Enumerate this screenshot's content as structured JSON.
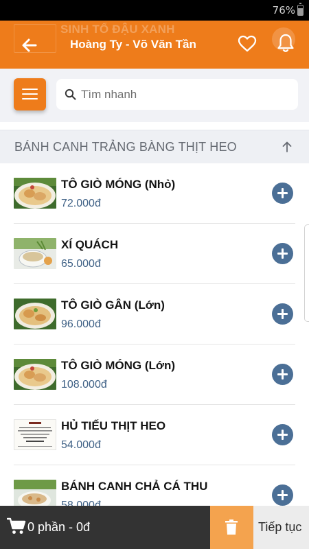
{
  "status_bar": {
    "battery": "76%"
  },
  "header": {
    "title": "Hoàng Ty - Võ Văn Tần",
    "background_text": "SINH TỐ ĐẬU XANH",
    "background_color": "#ee7c1b"
  },
  "search": {
    "placeholder": "Tìm nhanh",
    "value": ""
  },
  "category": {
    "title": "BÁNH CANH TRẢNG BÀNG THỊT HEO"
  },
  "items": [
    {
      "name": "TÔ GIÒ MÓNG (Nhỏ)",
      "price": "72.000đ",
      "thumb": "pork-leg-bowl"
    },
    {
      "name": "XÍ QUÁCH",
      "price": "65.000đ",
      "thumb": "bone-broth"
    },
    {
      "name": "TÔ GIÒ GÂN (Lớn)",
      "price": "96.000đ",
      "thumb": "pork-leg-bowl"
    },
    {
      "name": "TÔ GIÒ MÓNG (Lớn)",
      "price": "108.000đ",
      "thumb": "pork-leg-bowl"
    },
    {
      "name": "HỦ TIẾU THỊT HEO",
      "price": "54.000đ",
      "thumb": "business-card"
    },
    {
      "name": "BÁNH CANH CHẢ CÁ THU",
      "price": "58.000đ",
      "thumb": "fish-noodle"
    }
  ],
  "cart": {
    "summary": "0 phần -  0đ"
  },
  "footer": {
    "continue_label": "Tiếp tục"
  },
  "colors": {
    "accent": "#ee7c1b",
    "price": "#3f6186",
    "add_button": "#4b6f96",
    "bottom_bar": "#333333",
    "trash": "#f4a34e"
  }
}
